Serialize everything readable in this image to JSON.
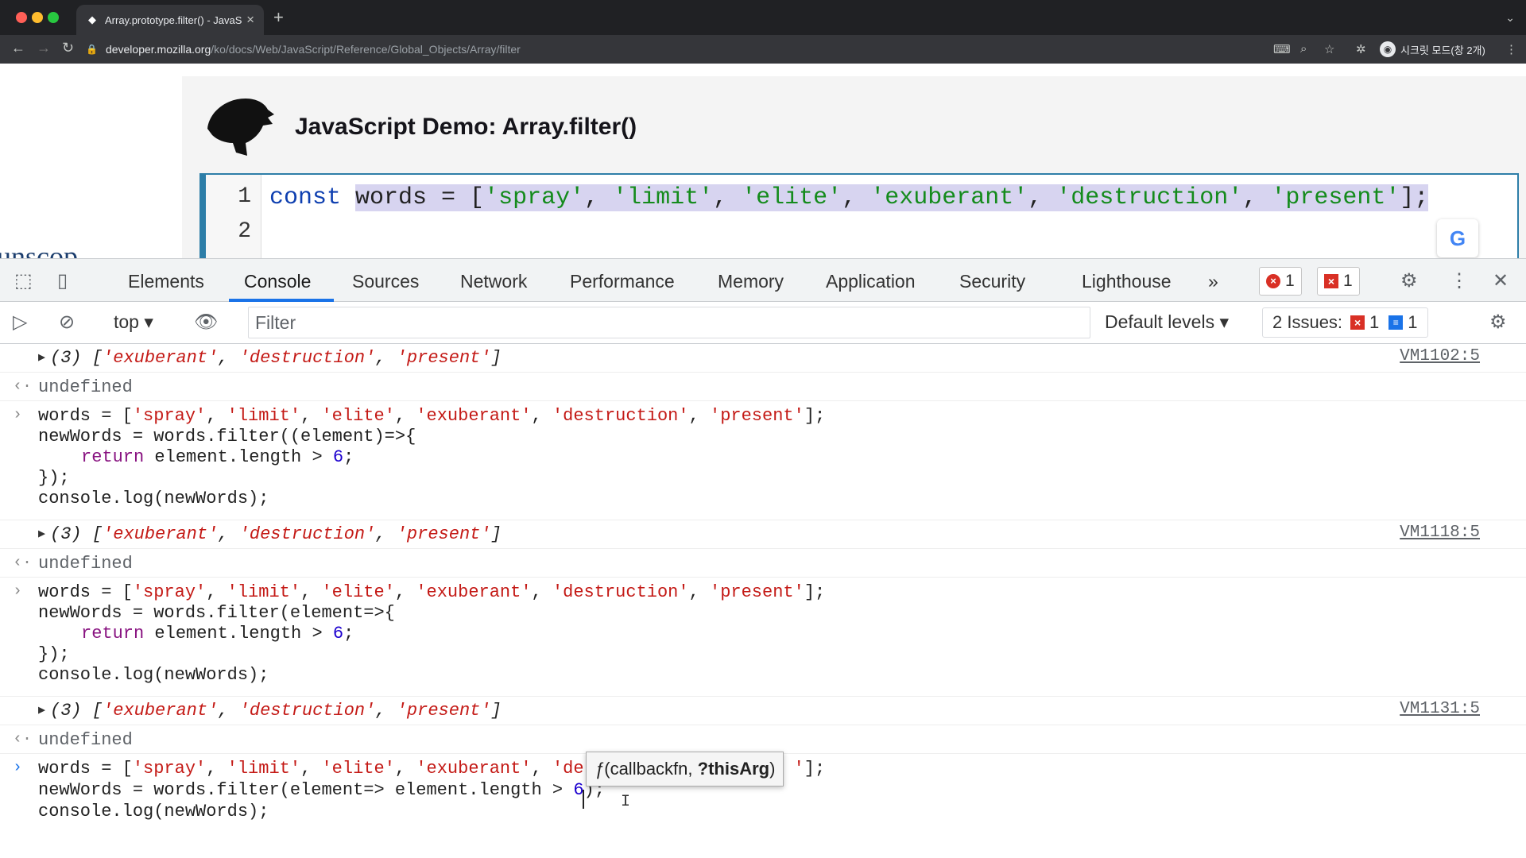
{
  "browser": {
    "tab_title": "Array.prototype.filter() - JavaS",
    "url_host": "developer.mozilla.org",
    "url_path": "/ko/docs/Web/JavaScript/Reference/Global_Objects/Array/filter",
    "profile_label": "시크릿 모드(창 2개)",
    "colors": {
      "chrome_dark": "#202124",
      "toolbar": "#35363a"
    }
  },
  "page": {
    "left_fragment": "unscop",
    "demo_title": "JavaScript Demo: Array.filter()",
    "editor": {
      "line_numbers": [
        "1",
        "2"
      ],
      "line1": {
        "kw": "const",
        "sel_a": "words = [",
        "s1": "'spray'",
        "s2": "'limit'",
        "s3": "'elite'",
        "s4": "'exuberant'",
        "s5": "'destruction'",
        "s6": "'present'",
        "comma": ", ",
        "end": "];"
      }
    }
  },
  "devtools": {
    "tabs": [
      "Elements",
      "Console",
      "Sources",
      "Network",
      "Performance",
      "Memory",
      "Application",
      "Security",
      "Lighthouse"
    ],
    "more": "»",
    "error_count": "1",
    "issue_count": "1",
    "context": "top",
    "filter_placeholder": "Filter",
    "levels": "Default levels",
    "issues_label": "2 Issues:",
    "issues_err": "1",
    "issues_info": "1"
  },
  "console": {
    "result_prefix": "(3) [",
    "result_s1": "'exuberant'",
    "result_s2": "'destruction'",
    "result_s3": "'present'",
    "result_sep": ", ",
    "result_end": "]",
    "undefined": "undefined",
    "src1": "VM1102:5",
    "src2": "VM1118:5",
    "src3": "VM1131:5",
    "words_pre": "words = [",
    "w1": "'spray'",
    "w2": "'limit'",
    "w3": "'elite'",
    "w4": "'exuberant'",
    "w5": "'destruction'",
    "w6": "'present'",
    "w5_partial": "'de",
    "w6_tail": "'",
    "sep": ", ",
    "words_end": "];",
    "block1": {
      "l2": "newWords = words.filter((element)=>{",
      "l3_kw": "return",
      "l3_rest": " element.length > ",
      "num": "6",
      "semi": ";",
      "l4": "});",
      "l5": "console.log(newWords);"
    },
    "block2": {
      "l2": "newWords = words.filter(element=>{"
    },
    "block3": {
      "l2_a": "newWords = words.filter(element=> element.length > ",
      "l2_num": "6",
      "l2_end": ");"
    },
    "tooltip": {
      "fn": "ƒ",
      "open": "(callbackfn, ",
      "bold": "?thisArg",
      "close": ")"
    }
  }
}
